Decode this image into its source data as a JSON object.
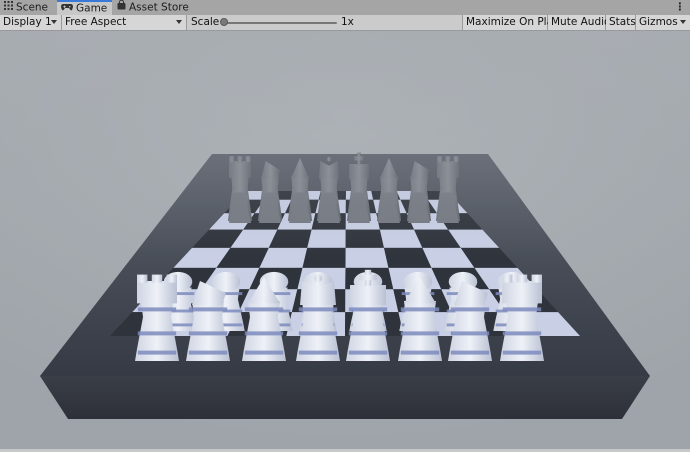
{
  "tabs": [
    {
      "label": "Scene",
      "icon": "grid-icon",
      "active": false
    },
    {
      "label": "Game",
      "icon": "gamepad-icon",
      "active": true
    },
    {
      "label": "Asset Store",
      "icon": "bag-icon",
      "active": false
    }
  ],
  "toolbar": {
    "display": "Display 1",
    "aspect": "Free Aspect",
    "scale_label": "Scale",
    "scale_value": "1x",
    "scale_fraction": 0.0,
    "maximize": "Maximize On Play",
    "mute": "Mute Audio",
    "stats": "Stats",
    "gizmos": "Gizmos"
  },
  "viewport": {
    "scene": "chess-board",
    "colors": {
      "background": "#a4aaaf",
      "board_frame": "#3a3f48",
      "light_square": "#c9d0e6",
      "dark_square": "#2f333b",
      "pieces": "#e3e7f1",
      "piece_shade": "#7d8bbd"
    }
  }
}
